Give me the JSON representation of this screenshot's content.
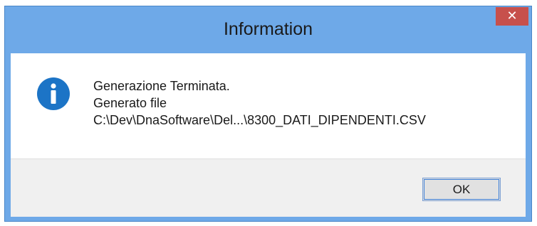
{
  "dialog": {
    "title": "Information",
    "close_icon": "close-icon",
    "close_glyph": "✕",
    "message_lines": [
      "Generazione Terminata.",
      "Generato file",
      "C:\\Dev\\DnaSoftware\\Del...\\8300_DATI_DIPENDENTI.CSV"
    ],
    "icon": "info-icon",
    "ok_label": "OK"
  },
  "colors": {
    "title_bar": "#6ea9e8",
    "close_button": "#c7504c",
    "info_icon": "#1c74c6"
  }
}
